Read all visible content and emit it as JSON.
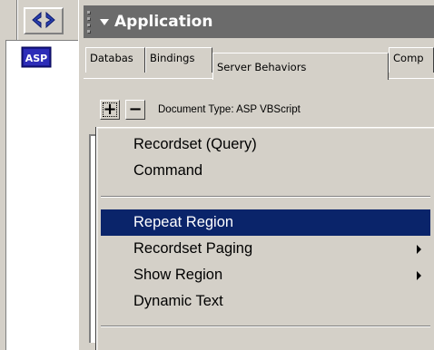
{
  "left_strip": {
    "code_button_icon": "code-tag-icon",
    "asp_icon_label": "ASP"
  },
  "panel": {
    "title": "Application",
    "tabs": [
      {
        "label": "Databases",
        "shown": "Databas"
      },
      {
        "label": "Bindings",
        "shown": "Bindings"
      },
      {
        "label": "Server Behaviors",
        "shown": "Server Behaviors"
      },
      {
        "label": "Components",
        "shown": "Comp"
      }
    ],
    "toolbar": {
      "plus_label": "+",
      "minus_label": "−",
      "document_type": "Document Type: ASP VBScript"
    }
  },
  "menu": {
    "items": [
      {
        "label": "Recordset (Query)",
        "submenu": false
      },
      {
        "label": "Command",
        "submenu": false
      },
      {
        "label": "Repeat Region",
        "submenu": false,
        "highlighted": true
      },
      {
        "label": "Recordset Paging",
        "submenu": true
      },
      {
        "label": "Show Region",
        "submenu": true
      },
      {
        "label": "Dynamic Text",
        "submenu": false
      }
    ]
  },
  "colors": {
    "titlebar": "#6b6b6b",
    "highlight": "#0a246a",
    "face": "#d4d0c8"
  }
}
